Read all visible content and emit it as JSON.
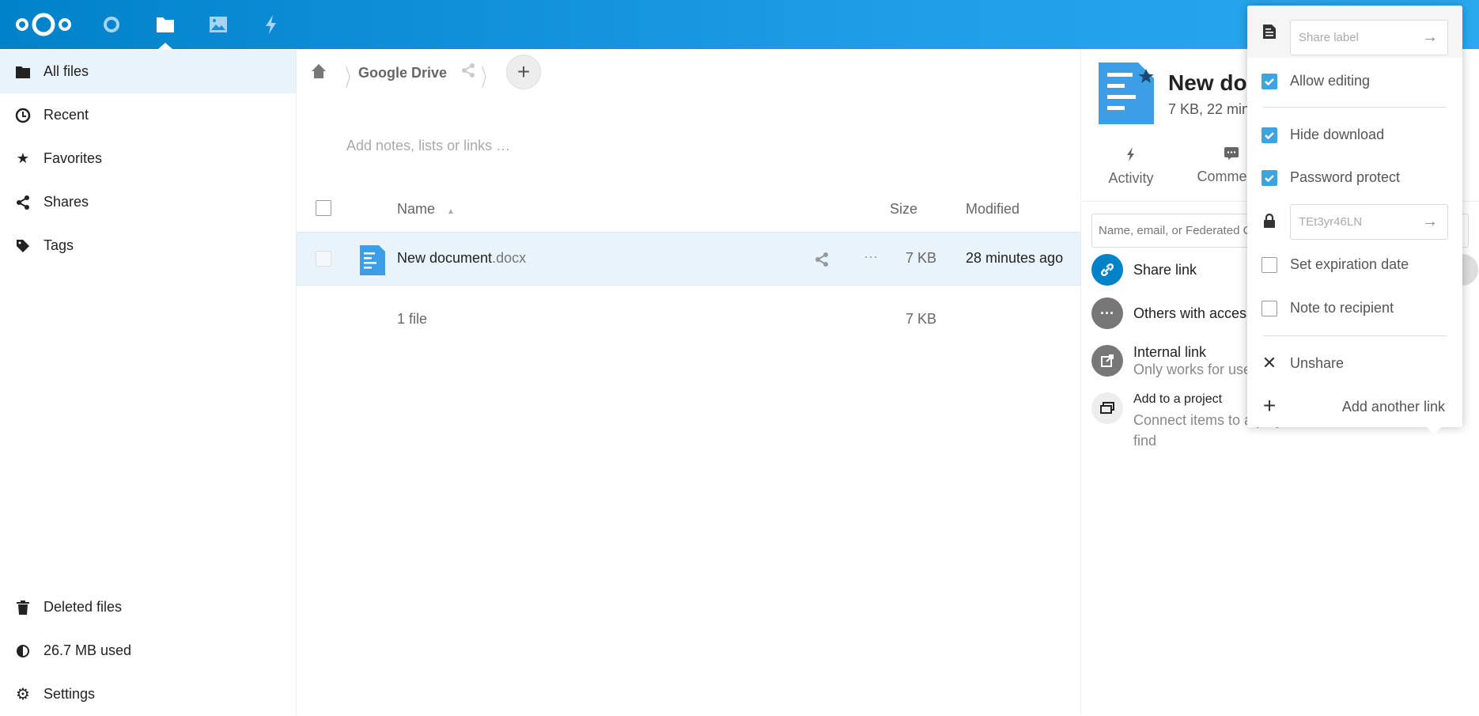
{
  "header": {
    "apps": [
      "dashboard",
      "files",
      "photos",
      "activity"
    ],
    "accent": "#0082c9"
  },
  "sidebar": {
    "items": [
      {
        "label": "All files",
        "icon": "folder-icon"
      },
      {
        "label": "Recent",
        "icon": "clock-icon"
      },
      {
        "label": "Favorites",
        "icon": "star-icon"
      },
      {
        "label": "Shares",
        "icon": "share-icon"
      },
      {
        "label": "Tags",
        "icon": "tag-icon"
      }
    ],
    "bottom": [
      {
        "label": "Deleted files",
        "icon": "trash-icon"
      },
      {
        "label": "26.7 MB used",
        "icon": "pie-icon"
      },
      {
        "label": "Settings",
        "icon": "gear-icon"
      }
    ]
  },
  "main": {
    "breadcrumb": "Google Drive",
    "notes_placeholder": "Add notes, lists or links …",
    "columns": {
      "name": "Name",
      "size": "Size",
      "modified": "Modified"
    },
    "files": [
      {
        "name": "New document",
        "ext": ".docx",
        "size": "7 KB",
        "modified": "28 minutes ago"
      }
    ],
    "summary": {
      "count": "1 file",
      "size": "7 KB"
    }
  },
  "panel": {
    "title": "New document.docx",
    "subtitle": "7 KB, 22 minutes ago",
    "tabs": [
      "Activity",
      "Comments"
    ],
    "share_placeholder": "Name, email, or Federated Cloud ID …",
    "share_link": "Share link",
    "others": "Others with access",
    "internal_title": "Internal link",
    "internal_sub": "Only works for users with access to this folder",
    "project_title": "Add to a project",
    "project_sub": "Connect items to a project to make them easier to find"
  },
  "popover": {
    "share_label_placeholder": "Share label",
    "allow_editing": {
      "label": "Allow editing",
      "checked": true
    },
    "hide_download": {
      "label": "Hide download",
      "checked": true
    },
    "password_protect": {
      "label": "Password protect",
      "checked": true
    },
    "password_value": "TEt3yr46LN",
    "expiration": {
      "label": "Set expiration date",
      "checked": false
    },
    "note": {
      "label": "Note to recipient",
      "checked": false
    },
    "unshare": "Unshare",
    "add_another": "Add another link"
  }
}
